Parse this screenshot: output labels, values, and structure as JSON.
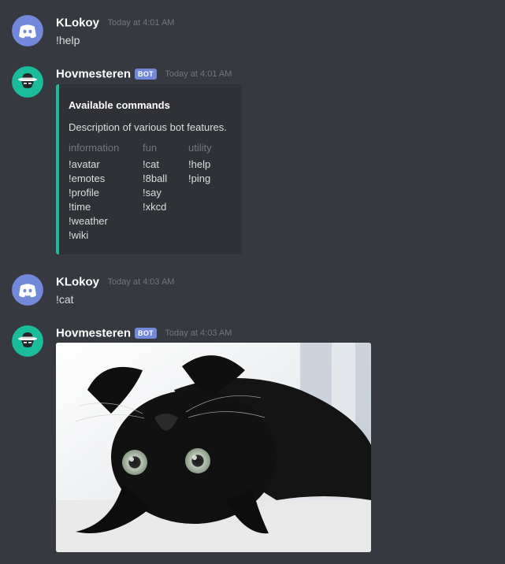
{
  "messages": [
    {
      "username": "KLokoy",
      "timestamp": "Today at 4:01 AM",
      "content": "!help",
      "avatar_icon": "discord-logo-icon",
      "avatar_color": "#7289da"
    },
    {
      "username": "Hovmesteren",
      "bot_tag": "BOT",
      "timestamp": "Today at 4:01 AM",
      "avatar_icon": "bot-hat-icon",
      "avatar_color": "#1abc9c",
      "embed": {
        "accent_color": "#1abc9c",
        "title": "Available commands",
        "description": "Description of various bot features.",
        "fields": [
          {
            "name": "information",
            "values": [
              "!avatar",
              "!emotes",
              "!profile",
              "!time",
              "!weather",
              "!wiki"
            ]
          },
          {
            "name": "fun",
            "values": [
              "!cat",
              "!8ball",
              "!say",
              "!xkcd"
            ]
          },
          {
            "name": "utility",
            "values": [
              "!help",
              "!ping"
            ]
          }
        ]
      }
    },
    {
      "username": "KLokoy",
      "timestamp": "Today at 4:03 AM",
      "content": "!cat",
      "avatar_icon": "discord-logo-icon",
      "avatar_color": "#7289da"
    },
    {
      "username": "Hovmesteren",
      "bot_tag": "BOT",
      "timestamp": "Today at 4:03 AM",
      "avatar_icon": "bot-hat-icon",
      "avatar_color": "#1abc9c",
      "attachment": {
        "kind": "image",
        "subject": "black-cat-photo"
      }
    }
  ]
}
